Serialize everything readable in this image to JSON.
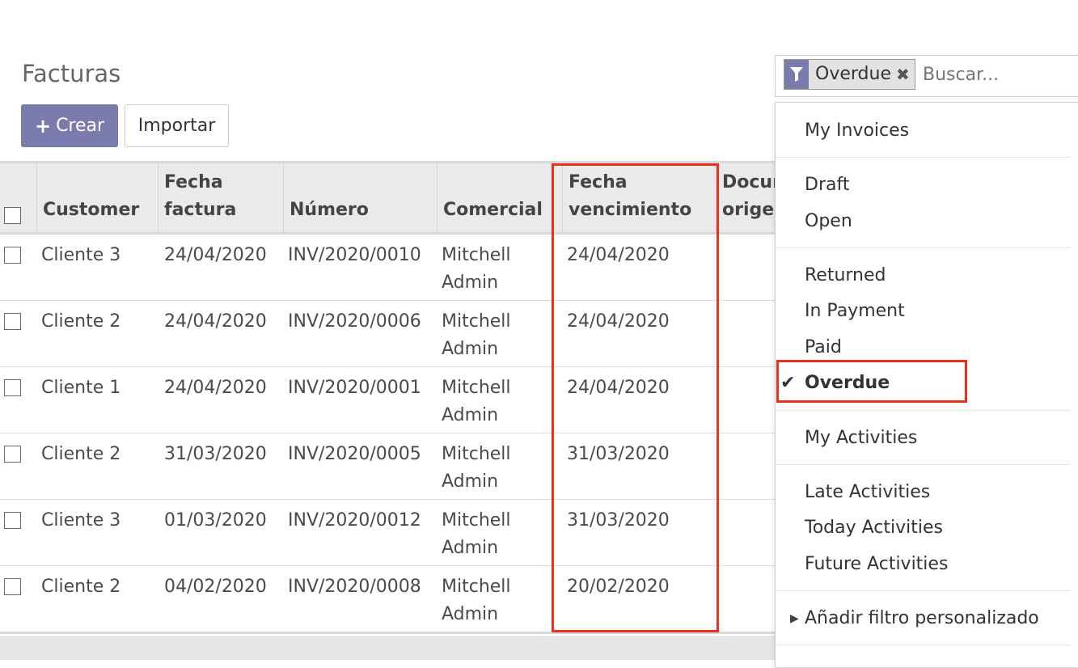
{
  "page": {
    "title": "Facturas"
  },
  "toolbar": {
    "create_label": "Crear",
    "import_label": "Importar"
  },
  "search": {
    "facet_value": "Overdue",
    "placeholder": "Buscar..."
  },
  "table": {
    "headers": [
      "Customer",
      "Fecha\nfactura",
      "Número",
      "Comercial",
      "Fecha\nvencimiento",
      "Docur\norigen"
    ],
    "rows": [
      {
        "customer": "Cliente 3",
        "fecha_factura": "24/04/2020",
        "numero": "INV/2020/0010",
        "comercial": "Mitchell\nAdmin",
        "vencimiento": "24/04/2020"
      },
      {
        "customer": "Cliente 2",
        "fecha_factura": "24/04/2020",
        "numero": "INV/2020/0006",
        "comercial": "Mitchell\nAdmin",
        "vencimiento": "24/04/2020"
      },
      {
        "customer": "Cliente 1",
        "fecha_factura": "24/04/2020",
        "numero": "INV/2020/0001",
        "comercial": "Mitchell\nAdmin",
        "vencimiento": "24/04/2020"
      },
      {
        "customer": "Cliente 2",
        "fecha_factura": "31/03/2020",
        "numero": "INV/2020/0005",
        "comercial": "Mitchell\nAdmin",
        "vencimiento": "31/03/2020"
      },
      {
        "customer": "Cliente 3",
        "fecha_factura": "01/03/2020",
        "numero": "INV/2020/0012",
        "comercial": "Mitchell\nAdmin",
        "vencimiento": "31/03/2020"
      },
      {
        "customer": "Cliente 2",
        "fecha_factura": "04/02/2020",
        "numero": "INV/2020/0008",
        "comercial": "Mitchell\nAdmin",
        "vencimiento": "20/02/2020"
      }
    ]
  },
  "filters": {
    "items": [
      "My Invoices",
      "Draft",
      "Open",
      "Returned",
      "In Payment",
      "Paid",
      "Overdue",
      "My Activities",
      "Late Activities",
      "Today Activities",
      "Future Activities"
    ],
    "custom_filter": "Añadir filtro personalizado",
    "checked_item": "Overdue"
  },
  "colors": {
    "accent": "#7c7bad",
    "highlight": "#e8321e"
  },
  "icons": {
    "create": "plus-icon",
    "facet": "filter-icon",
    "facet_remove": "close-icon",
    "checked": "check-icon",
    "expand": "caret-right-icon"
  }
}
